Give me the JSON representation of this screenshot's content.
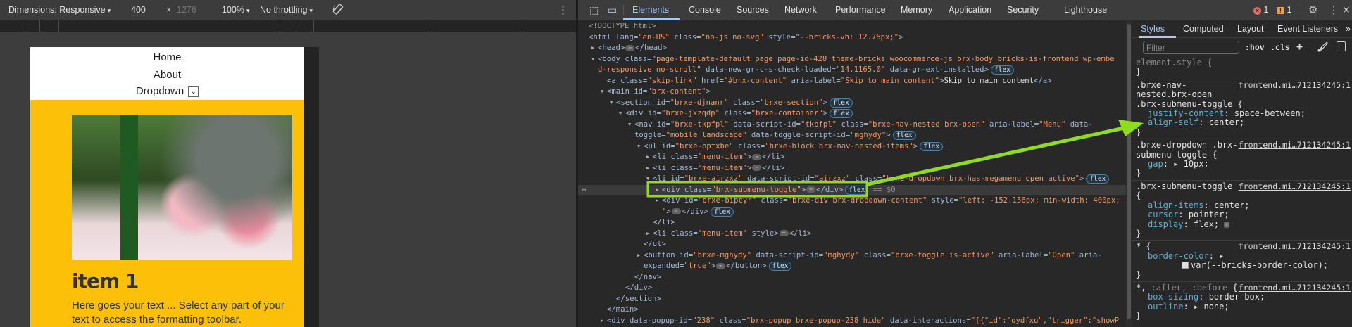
{
  "device_toolbar": {
    "dimensions": "Dimensions: Responsive",
    "width": "400",
    "times": "×",
    "height": "1276",
    "zoom": "100%",
    "throttling": "No throttling",
    "caret": "▾",
    "more": "⋮"
  },
  "device_page": {
    "nav": [
      "Home",
      "About",
      "Dropdown"
    ],
    "dropdown_chevron": "⌄",
    "item_title": "item 1",
    "item_text": "Here goes your text ... Select any part of your text to access the formatting toolbar."
  },
  "devtools": {
    "tabs": [
      "Elements",
      "Console",
      "Sources",
      "Network",
      "Performance",
      "Memory",
      "Application",
      "Security",
      "Lighthouse"
    ],
    "active_tab": "Elements",
    "errors": "1",
    "warnings": "1",
    "colors": {
      "accent": "#a8c7fa",
      "error": "#e46962",
      "warning": "#f09c4b",
      "highlight": "#8fdc1e"
    }
  },
  "dom_lines": [
    {
      "d": 0,
      "tri": "",
      "tk": [
        [
          "c",
          "<!DOCTYPE html>"
        ]
      ]
    },
    {
      "d": 0,
      "tri": "",
      "tk": [
        [
          "t",
          "<html"
        ],
        [
          "a",
          " lang"
        ],
        [
          "t",
          "="
        ],
        [
          "v",
          "\"en-US\""
        ],
        [
          "a",
          " class"
        ],
        [
          "t",
          "="
        ],
        [
          "v",
          "\"no-js no-svg\""
        ],
        [
          "a",
          " style"
        ],
        [
          "t",
          "="
        ],
        [
          "v",
          "\"--bricks-vh: 12.76px;\""
        ],
        [
          "t",
          ">"
        ]
      ]
    },
    {
      "d": 1,
      "tri": "c",
      "tk": [
        [
          "t",
          "<head>"
        ],
        [
          "e",
          "⋯"
        ],
        [
          "t",
          "</head>"
        ]
      ]
    },
    {
      "d": 1,
      "tri": "o",
      "tk": [
        [
          "t",
          "<body"
        ],
        [
          "a",
          " class"
        ],
        [
          "t",
          "="
        ],
        [
          "v",
          "\"page-template-default page page-id-428 theme-bricks woocommerce-js brx-body bricks-is-frontend wp-embe"
        ]
      ]
    },
    {
      "d": 1,
      "tri": "",
      "tk": [
        [
          "v",
          "d-responsive no-scroll\""
        ],
        [
          "a",
          " data-new-gr-c-s-check-loaded"
        ],
        [
          "t",
          "="
        ],
        [
          "v",
          "\"14.1165.0\""
        ],
        [
          "a",
          " data-gr-ext-installed"
        ],
        [
          "t",
          ">"
        ],
        [
          "b",
          "flex"
        ]
      ]
    },
    {
      "d": 2,
      "tri": "",
      "tk": [
        [
          "t",
          "<a"
        ],
        [
          "a",
          " class"
        ],
        [
          "t",
          "="
        ],
        [
          "v",
          "\"skip-link\""
        ],
        [
          "a",
          " href"
        ],
        [
          "t",
          "="
        ],
        [
          "u",
          "\"#brx-content\""
        ],
        [
          "a",
          " aria-label"
        ],
        [
          "t",
          "="
        ],
        [
          "v",
          "\"Skip to main content\""
        ],
        [
          "t",
          ">"
        ],
        [
          "x",
          "Skip to main content"
        ],
        [
          "t",
          "</a>"
        ]
      ]
    },
    {
      "d": 2,
      "tri": "o",
      "tk": [
        [
          "t",
          "<main"
        ],
        [
          "a",
          " id"
        ],
        [
          "t",
          "="
        ],
        [
          "v",
          "\"brx-content\""
        ],
        [
          "t",
          ">"
        ]
      ]
    },
    {
      "d": 3,
      "tri": "o",
      "tk": [
        [
          "t",
          "<section"
        ],
        [
          "a",
          " id"
        ],
        [
          "t",
          "="
        ],
        [
          "v",
          "\"brxe-djnanr\""
        ],
        [
          "a",
          " class"
        ],
        [
          "t",
          "="
        ],
        [
          "v",
          "\"brxe-section\""
        ],
        [
          "t",
          ">"
        ],
        [
          "b",
          "flex"
        ]
      ]
    },
    {
      "d": 4,
      "tri": "o",
      "tk": [
        [
          "t",
          "<div"
        ],
        [
          "a",
          " id"
        ],
        [
          "t",
          "="
        ],
        [
          "v",
          "\"brxe-jxzqdp\""
        ],
        [
          "a",
          " class"
        ],
        [
          "t",
          "="
        ],
        [
          "v",
          "\"brxe-container\""
        ],
        [
          "t",
          ">"
        ],
        [
          "b",
          "flex"
        ]
      ]
    },
    {
      "d": 5,
      "tri": "o",
      "tk": [
        [
          "t",
          "<nav"
        ],
        [
          "a",
          " id"
        ],
        [
          "t",
          "="
        ],
        [
          "v",
          "\"brxe-tkpfpl\""
        ],
        [
          "a",
          " data-script-id"
        ],
        [
          "t",
          "="
        ],
        [
          "v",
          "\"tkpfpl\""
        ],
        [
          "a",
          " class"
        ],
        [
          "t",
          "="
        ],
        [
          "v",
          "\"brxe-nav-nested brx-open\""
        ],
        [
          "a",
          " aria-label"
        ],
        [
          "t",
          "="
        ],
        [
          "v",
          "\"Menu\""
        ],
        [
          "a",
          " data-"
        ]
      ]
    },
    {
      "d": 5,
      "tri": "",
      "tk": [
        [
          "a",
          "toggle"
        ],
        [
          "t",
          "="
        ],
        [
          "v",
          "\"mobile_landscape\""
        ],
        [
          "a",
          " data-toggle-script-id"
        ],
        [
          "t",
          "="
        ],
        [
          "v",
          "\"mghydy\""
        ],
        [
          "t",
          ">"
        ],
        [
          "b",
          "flex"
        ]
      ]
    },
    {
      "d": 6,
      "tri": "o",
      "tk": [
        [
          "t",
          "<ul"
        ],
        [
          "a",
          " id"
        ],
        [
          "t",
          "="
        ],
        [
          "v",
          "\"brxe-optxbe\""
        ],
        [
          "a",
          " class"
        ],
        [
          "t",
          "="
        ],
        [
          "v",
          "\"brxe-block brx-nav-nested-items\""
        ],
        [
          "t",
          ">"
        ],
        [
          "b",
          "flex"
        ]
      ]
    },
    {
      "d": 7,
      "tri": "c",
      "tk": [
        [
          "t",
          "<li"
        ],
        [
          "a",
          " class"
        ],
        [
          "t",
          "="
        ],
        [
          "v",
          "\"menu-item\""
        ],
        [
          "t",
          ">"
        ],
        [
          "e",
          "⋯"
        ],
        [
          "t",
          "</li>"
        ]
      ]
    },
    {
      "d": 7,
      "tri": "c",
      "tk": [
        [
          "t",
          "<li"
        ],
        [
          "a",
          " class"
        ],
        [
          "t",
          "="
        ],
        [
          "v",
          "\"menu-item\""
        ],
        [
          "t",
          ">"
        ],
        [
          "e",
          "⋯"
        ],
        [
          "t",
          "</li>"
        ]
      ]
    },
    {
      "d": 7,
      "tri": "o",
      "tk": [
        [
          "t",
          "<li"
        ],
        [
          "a",
          " id"
        ],
        [
          "t",
          "="
        ],
        [
          "v",
          "\"brxe-airzxz\""
        ],
        [
          "a",
          " data-script-id"
        ],
        [
          "t",
          "="
        ],
        [
          "v",
          "\"airzxz\""
        ],
        [
          "a",
          " class"
        ],
        [
          "t",
          "="
        ],
        [
          "v",
          "\"brxe-dropdown brx-has-megamenu open active\""
        ],
        [
          "t",
          ">"
        ],
        [
          "b",
          "flex"
        ]
      ]
    },
    {
      "d": 8,
      "tri": "c",
      "sel": true,
      "tk": [
        [
          "t",
          "<div"
        ],
        [
          "a",
          " class"
        ],
        [
          "t",
          "="
        ],
        [
          "v",
          "\"brx-submenu-toggle\""
        ],
        [
          "t",
          ">"
        ],
        [
          "e",
          "⋯"
        ],
        [
          "t",
          "</div>"
        ],
        [
          "b",
          "flex"
        ],
        [
          "s",
          " == $0"
        ]
      ]
    },
    {
      "d": 8,
      "tri": "c",
      "tk": [
        [
          "t",
          "<div"
        ],
        [
          "a",
          " id"
        ],
        [
          "t",
          "="
        ],
        [
          "v",
          "\"brxe-bipcyr\""
        ],
        [
          "a",
          " class"
        ],
        [
          "t",
          "="
        ],
        [
          "v",
          "\"brxe-div brx-dropdown-content\""
        ],
        [
          "a",
          " style"
        ],
        [
          "t",
          "="
        ],
        [
          "v",
          "\"left: -152.156px; min-width: 400px;"
        ]
      ]
    },
    {
      "d": 8,
      "tri": "",
      "tk": [
        [
          "v",
          "\""
        ],
        [
          "t",
          ">"
        ],
        [
          "e",
          "⋯"
        ],
        [
          "t",
          "</div>"
        ],
        [
          "b",
          "flex"
        ]
      ]
    },
    {
      "d": 7,
      "tri": "",
      "tk": [
        [
          "t",
          "</li>"
        ]
      ]
    },
    {
      "d": 7,
      "tri": "c",
      "tk": [
        [
          "t",
          "<li"
        ],
        [
          "a",
          " class"
        ],
        [
          "t",
          "="
        ],
        [
          "v",
          "\"menu-item\""
        ],
        [
          "a",
          " style"
        ],
        [
          "t",
          ">"
        ],
        [
          "e",
          "⋯"
        ],
        [
          "t",
          "</li>"
        ]
      ]
    },
    {
      "d": 6,
      "tri": "",
      "tk": [
        [
          "t",
          "</ul>"
        ]
      ]
    },
    {
      "d": 6,
      "tri": "c",
      "tk": [
        [
          "t",
          "<button"
        ],
        [
          "a",
          " id"
        ],
        [
          "t",
          "="
        ],
        [
          "v",
          "\"brxe-mghydy\""
        ],
        [
          "a",
          " data-script-id"
        ],
        [
          "t",
          "="
        ],
        [
          "v",
          "\"mghydy\""
        ],
        [
          "a",
          " class"
        ],
        [
          "t",
          "="
        ],
        [
          "v",
          "\"brxe-toggle is-active\""
        ],
        [
          "a",
          " aria-label"
        ],
        [
          "t",
          "="
        ],
        [
          "v",
          "\"Open\""
        ],
        [
          "a",
          " aria-"
        ]
      ]
    },
    {
      "d": 6,
      "tri": "",
      "tk": [
        [
          "a",
          "expanded"
        ],
        [
          "t",
          "="
        ],
        [
          "v",
          "\"true\""
        ],
        [
          "t",
          ">"
        ],
        [
          "e",
          "⋯"
        ],
        [
          "t",
          "</button>"
        ],
        [
          "b",
          "flex"
        ]
      ]
    },
    {
      "d": 5,
      "tri": "",
      "tk": [
        [
          "t",
          "</nav>"
        ]
      ]
    },
    {
      "d": 4,
      "tri": "",
      "tk": [
        [
          "t",
          "</div>"
        ]
      ]
    },
    {
      "d": 3,
      "tri": "",
      "tk": [
        [
          "t",
          "</section>"
        ]
      ]
    },
    {
      "d": 2,
      "tri": "",
      "tk": [
        [
          "t",
          "</main>"
        ]
      ]
    },
    {
      "d": 2,
      "tri": "c",
      "tk": [
        [
          "t",
          "<div"
        ],
        [
          "a",
          " data-popup-id"
        ],
        [
          "t",
          "="
        ],
        [
          "v",
          "\"238\""
        ],
        [
          "a",
          " class"
        ],
        [
          "t",
          "="
        ],
        [
          "v",
          "\"brx-popup brxe-popup-238 hide\""
        ],
        [
          "a",
          " data-interactions"
        ],
        [
          "t",
          "="
        ],
        [
          "v",
          "\"[{\"id\":\"oydfxu\",\"trigger\":\"showP"
        ]
      ]
    }
  ],
  "styles_panel": {
    "tabs": [
      "Styles",
      "Computed",
      "Layout",
      "Event Listeners",
      "»"
    ],
    "filter_placeholder": "Filter",
    "hov": ":hov",
    "cls": ".cls",
    "rules": [
      {
        "sel": [
          "element.style {"
        ],
        "dim": true,
        "src": "",
        "decls": []
      },
      {
        "sel": [
          ".brxe-nav-",
          "nested.brx-open",
          ".brx-submenu-toggle {"
        ],
        "src": "frontend.mi…712134245:1",
        "decls": [
          {
            "p": "justify-content",
            "v": "space-between;"
          },
          {
            "p": "align-self",
            "v": "center;"
          }
        ]
      },
      {
        "sel": [
          ".brxe-dropdown .brx-",
          "submenu-toggle {"
        ],
        "src": "frontend.mi…712134245:1",
        "decls": [
          {
            "p": "gap",
            "v": "10px;",
            "arrow": true
          }
        ]
      },
      {
        "sel": [
          ".brx-submenu-toggle",
          "{"
        ],
        "src": "frontend.mi…712134245:1",
        "decls": [
          {
            "p": "align-items",
            "v": "center;"
          },
          {
            "p": "cursor",
            "v": "pointer;"
          },
          {
            "p": "display",
            "v": "flex;",
            "grid": true
          }
        ]
      },
      {
        "sel": [
          "* {"
        ],
        "src": "frontend.mi…712134245:1",
        "decls": [
          {
            "p": "border-color",
            "v": "",
            "arrow": true
          },
          {
            "p": "",
            "v": "var(--bricks-border-color);",
            "swatch": true
          }
        ]
      },
      {
        "sel": [
          "*, :after, :before {"
        ],
        "src": "frontend.mi…712134245:1",
        "decls": [
          {
            "p": "box-sizing",
            "v": "border-box;"
          },
          {
            "p": "outline",
            "v": "none;",
            "arrow": true
          }
        ]
      }
    ]
  }
}
